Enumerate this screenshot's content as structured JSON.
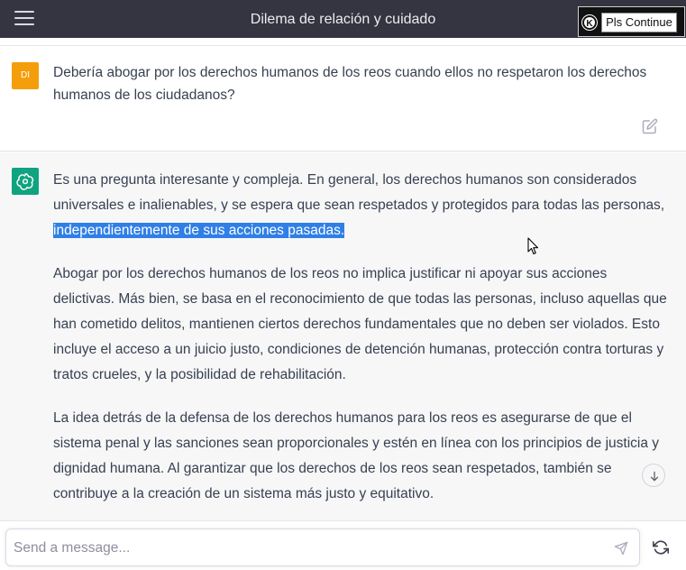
{
  "header": {
    "title": "Dilema de relación y cuidado",
    "menu_icon": "hamburger-menu-icon",
    "extension": {
      "logo_letter": "K",
      "button_label": "Pls Continue"
    }
  },
  "user_message": {
    "avatar_initials": "DI",
    "avatar_color": "#f59e0b",
    "text": "Debería abogar por los derechos humanos de los reos cuando ellos no respetaron los derechos humanos de los ciudadanos?",
    "edit_icon": "edit-icon"
  },
  "assistant_message": {
    "avatar_color": "#10a37f",
    "paragraphs": [
      {
        "before_highlight": "Es una pregunta interesante y compleja. En general, los derechos humanos son considerados universales e inalienables, y se espera que sean respetados y protegidos para todas las personas, ",
        "highlight": "independientemente de sus acciones pasadas."
      },
      "Abogar por los derechos humanos de los reos no implica justificar ni apoyar sus acciones delictivas. Más bien, se basa en el reconocimiento de que todas las personas, incluso aquellas que han cometido delitos, mantienen ciertos derechos fundamentales que no deben ser violados. Esto incluye el acceso a un juicio justo, condiciones de detención humanas, protección contra torturas y tratos crueles, y la posibilidad de rehabilitación.",
      "La idea detrás de la defensa de los derechos humanos para los reos es asegurarse de que el sistema penal y las sanciones sean proporcionales y estén en línea con los principios de justicia y dignidad humana. Al garantizar que los derechos de los reos sean respetados, también se contribuye a la creación de un sistema más justo y equitativo."
    ]
  },
  "composer": {
    "placeholder": "Send a message...",
    "value": "",
    "send_icon": "send-icon",
    "regenerate_icon": "regenerate-icon"
  },
  "scroll_down_icon": "arrow-down-icon",
  "colors": {
    "header_bg": "#343541",
    "highlight": "#2f7fe6",
    "assistant_bg": "#f7f7f8"
  }
}
